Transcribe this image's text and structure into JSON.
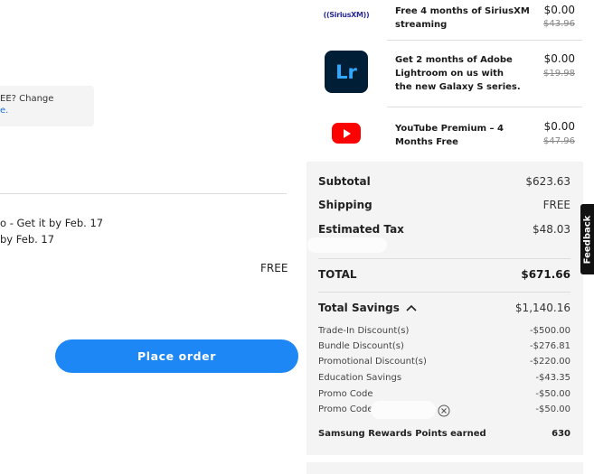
{
  "checkout": {
    "notice_line1": "EE? Change",
    "notice_line2": "e.",
    "shipping_line1": "o - Get it by Feb. 17",
    "shipping_line2": "by Feb. 17",
    "shipping_cost": "FREE",
    "place_order_label": "Place order"
  },
  "promos": [
    {
      "logo": "siriusxm-logo",
      "logo_text": "((SiriusXM))",
      "name": "Free 4 months of SiriusXM streaming",
      "price": "$0.00",
      "original_price": "$43.96"
    },
    {
      "logo": "lightroom-logo",
      "logo_text": "Lr",
      "name": "Get 2 months of Adobe Lightroom on us with the new Galaxy S series.",
      "price": "$0.00",
      "original_price": "$19.98"
    },
    {
      "logo": "youtube-logo",
      "logo_text": "",
      "name": "YouTube Premium – 4 Months Free",
      "price": "$0.00",
      "original_price": "$47.96"
    }
  ],
  "summary": {
    "subtotal_label": "Subtotal",
    "subtotal_value": "$623.63",
    "shipping_label": "Shipping",
    "shipping_value": "FREE",
    "tax_label": "Estimated Tax",
    "tax_value": "$48.03",
    "total_label": "TOTAL",
    "total_value": "$671.66",
    "savings_label": "Total Savings",
    "savings_value": "$1,140.16",
    "discounts": [
      {
        "label": "Trade-In Discount(s)",
        "value": "-$500.00"
      },
      {
        "label": "Bundle Discount(s)",
        "value": "-$276.81"
      },
      {
        "label": "Promotional Discount(s)",
        "value": "-$220.00"
      },
      {
        "label": "Education Savings",
        "value": "-$43.35"
      },
      {
        "label": "Promo Code",
        "value": "-$50.00"
      },
      {
        "label": "Promo Code",
        "value": "-$50.00"
      }
    ],
    "rewards_label": "Samsung Rewards Points earned",
    "rewards_value": "630"
  },
  "feedback_label": "Feedback",
  "colors": {
    "accent": "#1c87f5",
    "summary_bg": "#f4f4f4",
    "youtube_red": "#ff0000",
    "lightroom_bg": "#001e36",
    "lightroom_fg": "#31a8ff"
  }
}
